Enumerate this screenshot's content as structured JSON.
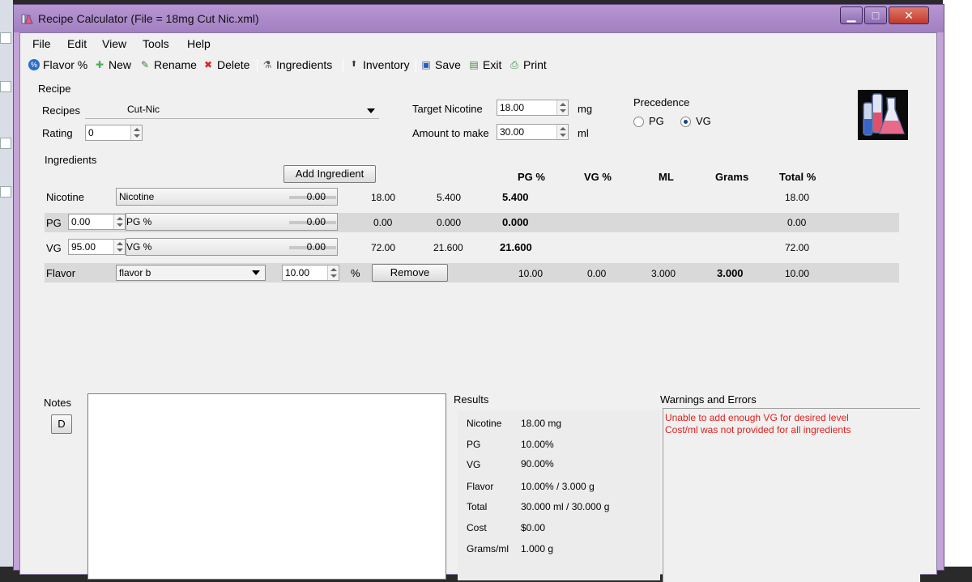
{
  "window": {
    "title": "Recipe Calculator (File = 18mg Cut Nic.xml)",
    "min_glyph": "▁",
    "max_glyph": "□",
    "close_glyph": "✕"
  },
  "menu": [
    {
      "label": "File"
    },
    {
      "label": "Edit"
    },
    {
      "label": "View"
    },
    {
      "label": "Tools"
    },
    {
      "label": "Help"
    }
  ],
  "toolbar": [
    {
      "label": "Flavor %",
      "icon": "flavor-percent-icon",
      "glyph": "%",
      "color": "#2a6fc9"
    },
    {
      "label": "New",
      "icon": "plus-icon",
      "glyph": "✚",
      "color": "#4caf50"
    },
    {
      "label": "Rename",
      "icon": "rename-icon",
      "glyph": "✎",
      "color": "#3c7d3c"
    },
    {
      "label": "Delete",
      "icon": "delete-icon",
      "glyph": "✖",
      "color": "#e02020"
    },
    {
      "label": "Ingredients",
      "icon": "ingredients-icon",
      "glyph": "⚗",
      "color": "#555555"
    },
    {
      "label": "Inventory",
      "icon": "inventory-icon",
      "glyph": "⬆",
      "color": "#333333"
    },
    {
      "label": "Save",
      "icon": "save-icon",
      "glyph": "▣",
      "color": "#2a5cb0"
    },
    {
      "label": "Exit",
      "icon": "exit-icon",
      "glyph": "▤",
      "color": "#3a8a3a"
    },
    {
      "label": "Print",
      "icon": "print-icon",
      "glyph": "⎙",
      "color": "#3a8a3a"
    }
  ],
  "recipe": {
    "section_label": "Recipe",
    "recipes_label": "Recipes",
    "recipe_name": "Cut-Nic",
    "rating_label": "Rating",
    "rating_value": "0",
    "target_nicotine_label": "Target Nicotine",
    "target_nicotine_value": "18.00",
    "target_nicotine_unit": "mg",
    "amount_label": "Amount to make",
    "amount_value": "30.00",
    "amount_unit": "ml",
    "precedence_label": "Precedence",
    "precedence_options": [
      "PG",
      "VG"
    ],
    "precedence_selected": "VG"
  },
  "ingredients": {
    "section_label": "Ingredients",
    "add_button": "Add Ingredient",
    "headers": [
      "PG %",
      "VG %",
      "ML",
      "Grams",
      "Total %"
    ],
    "nicotine": {
      "label": "Nicotine",
      "combo": "Nicotine",
      "slider_value": "0.00",
      "v1": "18.00",
      "v2": "5.400",
      "bold": "5.400",
      "total": "18.00"
    },
    "pg": {
      "label": "PG",
      "input": "0.00",
      "combo": "PG %",
      "slider_value": "0.00",
      "v1": "0.00",
      "v2": "0.000",
      "bold": "0.000",
      "total": "0.00"
    },
    "vg": {
      "label": "VG",
      "input": "95.00",
      "combo": "VG %",
      "slider_value": "0.00",
      "v1": "72.00",
      "v2": "21.600",
      "bold": "21.600",
      "total": "72.00"
    },
    "flavor": {
      "label": "Flavor",
      "select": "flavor b",
      "percent": "10.00",
      "percent_unit": "%",
      "remove": "Remove",
      "pg": "10.00",
      "vg": "0.00",
      "ml": "3.000",
      "grams": "3.000",
      "total": "10.00"
    }
  },
  "notes": {
    "label": "Notes",
    "d_button": "D"
  },
  "results": {
    "label": "Results",
    "rows": [
      {
        "name": "Nicotine",
        "value": "18.00 mg"
      },
      {
        "name": "PG",
        "value": "10.00%"
      },
      {
        "name": "VG",
        "value": "90.00%"
      },
      {
        "name": "Flavor",
        "value": "10.00% / 3.000 g"
      },
      {
        "name": "Total",
        "value": "30.000 ml / 30.000 g"
      },
      {
        "name": "Cost",
        "value": "$0.00"
      },
      {
        "name": "Grams/ml",
        "value": "1.000 g"
      }
    ]
  },
  "warnings": {
    "label": "Warnings and Errors",
    "messages": [
      "Unable to add enough VG for desired level",
      "Cost/ml was not provided for all ingredients"
    ],
    "color": "#e0201c"
  }
}
